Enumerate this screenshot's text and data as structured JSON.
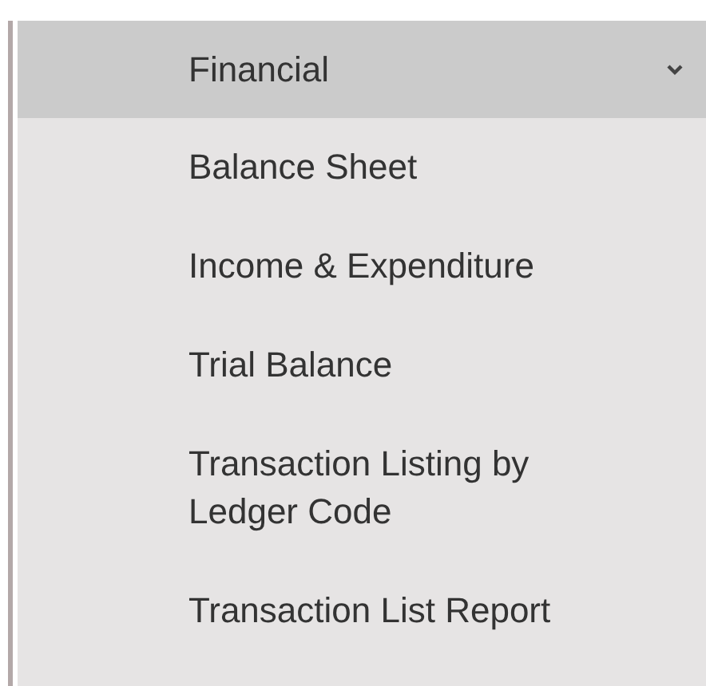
{
  "menu": {
    "header": {
      "label": "Financial",
      "expanded": true
    },
    "items": [
      {
        "label": "Balance Sheet"
      },
      {
        "label": "Income & Expenditure"
      },
      {
        "label": "Trial Balance"
      },
      {
        "label": "Transaction Listing by Ledger Code"
      },
      {
        "label": "Transaction List Report"
      }
    ]
  }
}
